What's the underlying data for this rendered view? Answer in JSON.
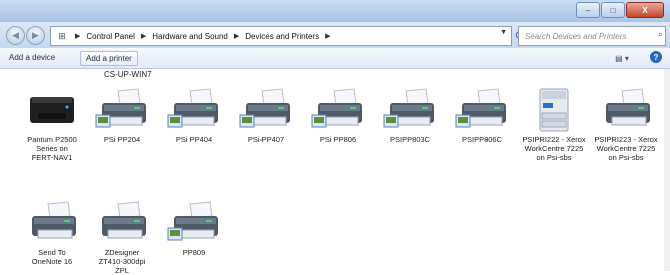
{
  "window": {
    "controls": [
      "–",
      "□",
      "X"
    ]
  },
  "address": {
    "breadcrumbs": [
      "Control Panel",
      "Hardware and Sound",
      "Devices and Printers"
    ]
  },
  "search": {
    "placeholder": "Search Devices and Printers"
  },
  "toolbar": {
    "add_device": "Add a device",
    "add_printer": "Add a printer"
  },
  "content": {
    "top_partial_label": "CS-UP-WIN7",
    "devices": [
      {
        "label": "Pantum P2500\nSeries on\nFERT-NAV1",
        "kind": "laser-black"
      },
      {
        "label": "PSi PP204",
        "kind": "printer-net"
      },
      {
        "label": "PSi PP404",
        "kind": "printer-net"
      },
      {
        "label": "PSi PP407",
        "kind": "printer-net"
      },
      {
        "label": "PSi PP806",
        "kind": "printer-net"
      },
      {
        "label": "PSIPP803C",
        "kind": "printer-net"
      },
      {
        "label": "PSIPP806C",
        "kind": "printer-net"
      },
      {
        "label": "PSIPRI222 - Xerox\nWorkCentre 7225\non Psi-sbs",
        "kind": "copier"
      },
      {
        "label": "PSIPRI223 - Xerox\nWorkCentre 7225\non Psi-sbs",
        "kind": "printer"
      },
      {
        "label": "Send To\nOneNote 16",
        "kind": "printer"
      },
      {
        "label": "ZDesigner\nZT410-300dpi\nZPL",
        "kind": "printer"
      },
      {
        "label": "PP809",
        "kind": "printer-net"
      }
    ]
  }
}
